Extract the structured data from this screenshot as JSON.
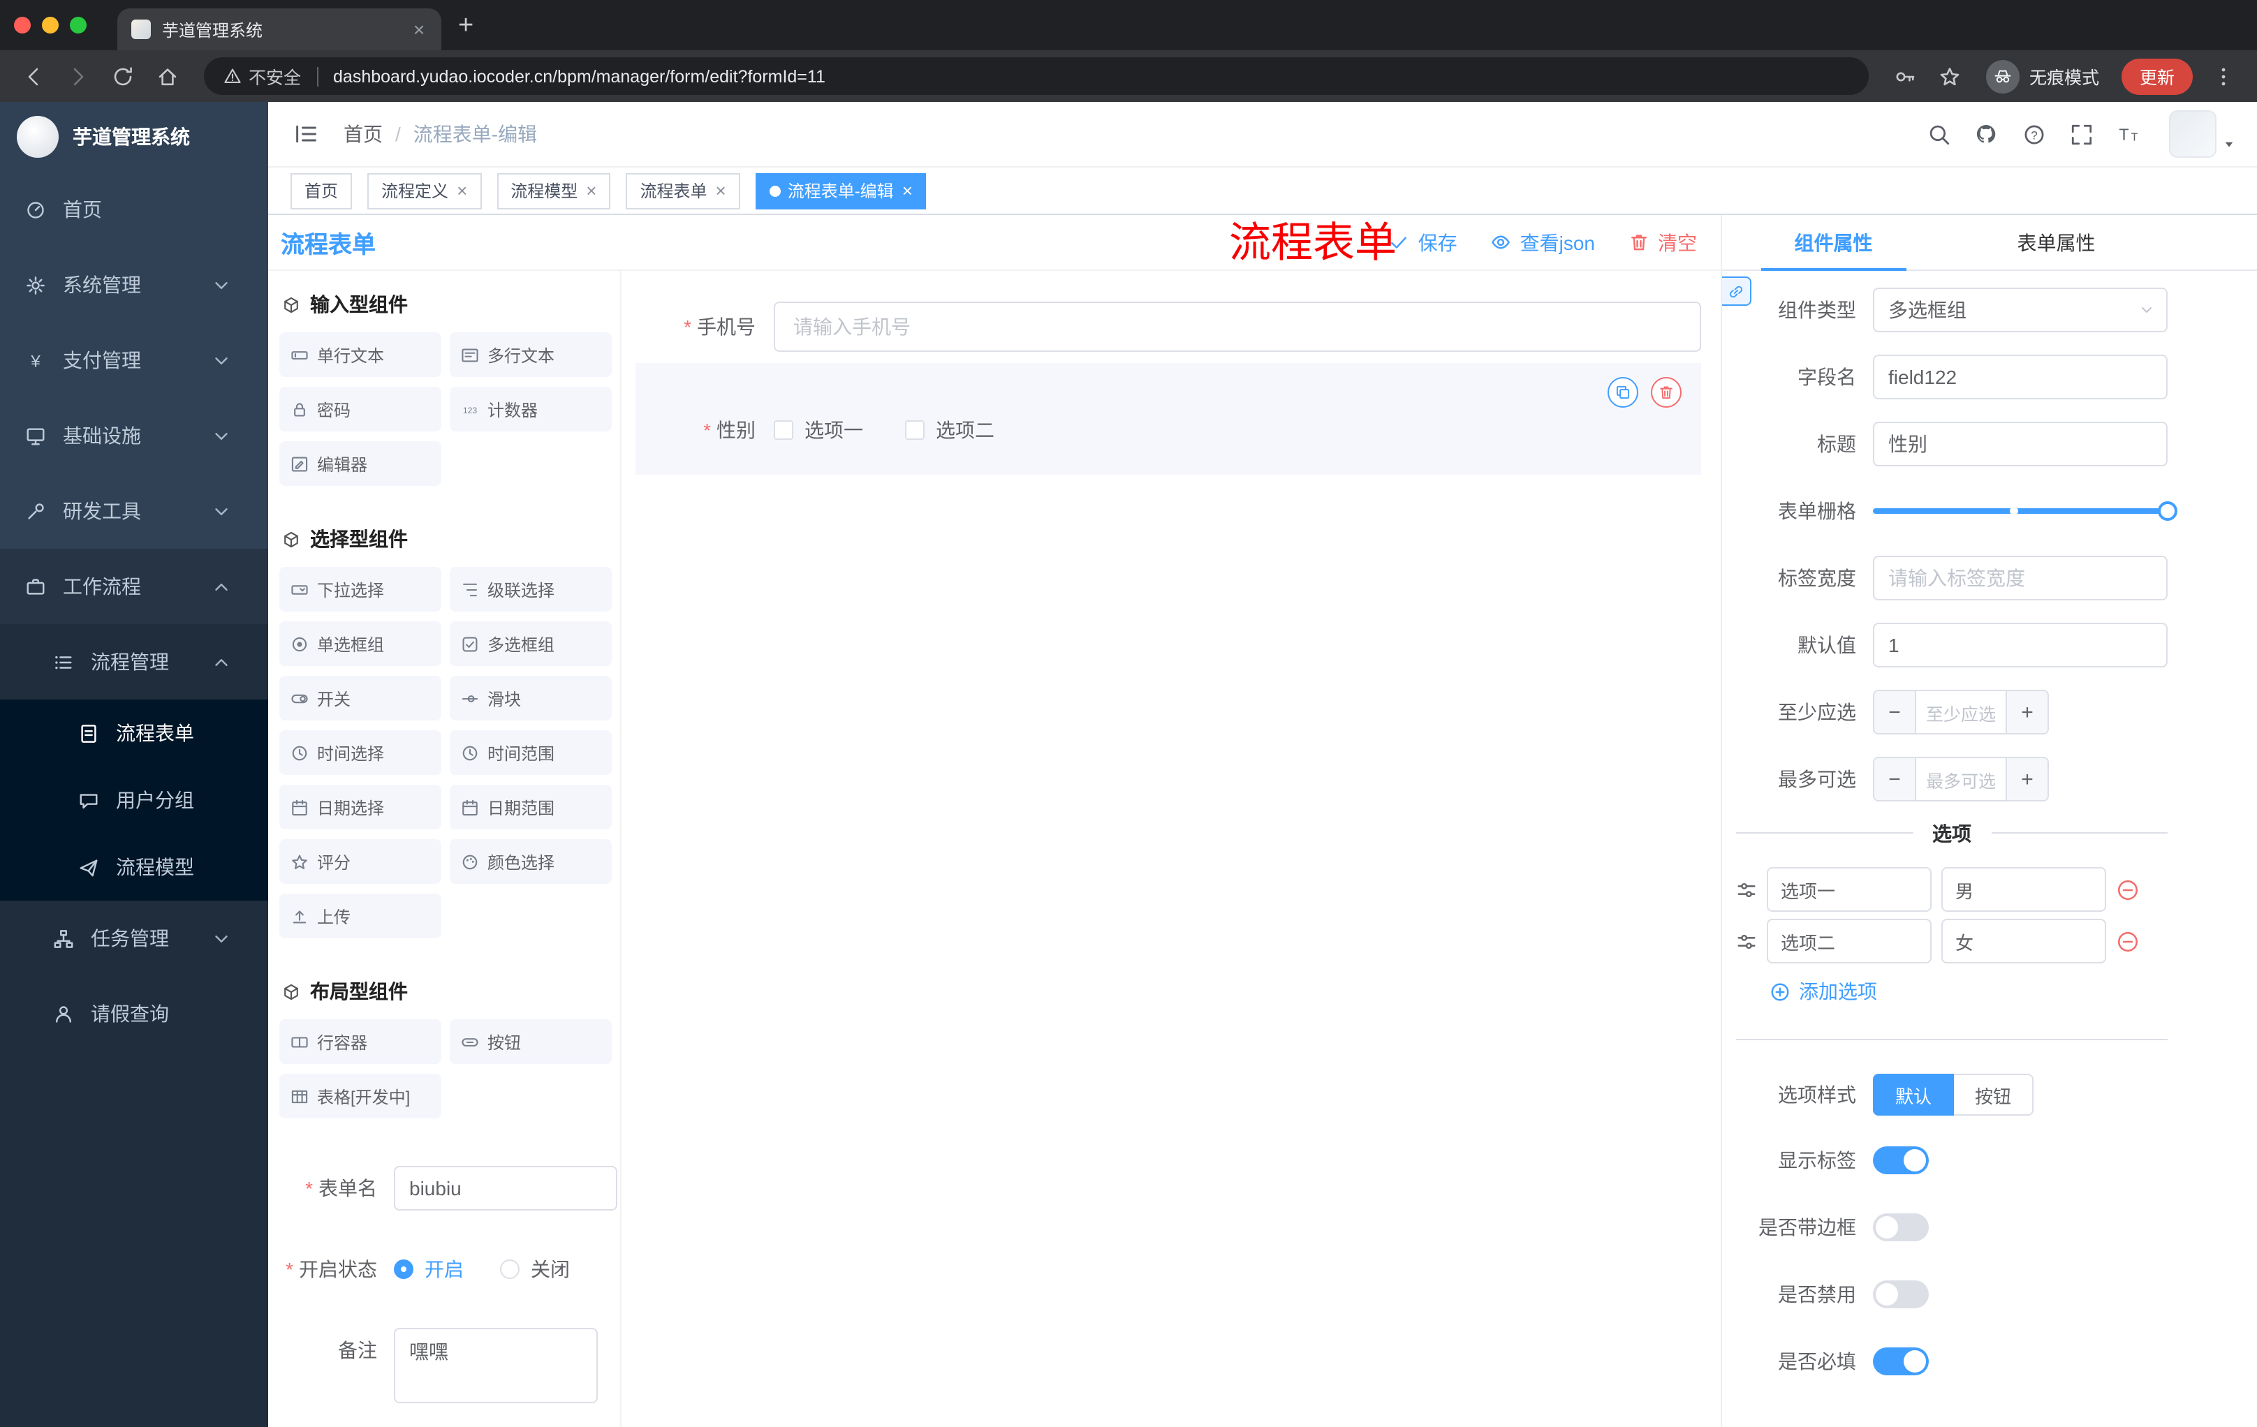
{
  "browser": {
    "tab_title": "芋道管理系统",
    "security_label": "不安全",
    "url": "dashboard.yudao.iocoder.cn/bpm/manager/form/edit?formId=11",
    "incognito_label": "无痕模式",
    "update_label": "更新"
  },
  "annotation": {
    "text": "流程表单",
    "color": "#f70000"
  },
  "sidebar": {
    "logo_title": "芋道管理系统",
    "items": [
      {
        "label": "首页"
      },
      {
        "label": "系统管理"
      },
      {
        "label": "支付管理"
      },
      {
        "label": "基础设施"
      },
      {
        "label": "研发工具"
      },
      {
        "label": "工作流程"
      },
      {
        "label": "流程管理"
      },
      {
        "label": "流程表单"
      },
      {
        "label": "用户分组"
      },
      {
        "label": "流程模型"
      },
      {
        "label": "任务管理"
      },
      {
        "label": "请假查询"
      }
    ]
  },
  "header": {
    "breadcrumb_home": "首页",
    "breadcrumb_current": "流程表单-编辑"
  },
  "tags": [
    {
      "label": "首页"
    },
    {
      "label": "流程定义"
    },
    {
      "label": "流程模型"
    },
    {
      "label": "流程表单"
    },
    {
      "label": "流程表单-编辑"
    }
  ],
  "designer": {
    "title": "流程表单",
    "actions": {
      "save": "保存",
      "view_json": "查看json",
      "clear": "清空"
    },
    "palette": {
      "sections": [
        {
          "title": "输入型组件",
          "items": [
            "单行文本",
            "多行文本",
            "密码",
            "计数器",
            "编辑器"
          ]
        },
        {
          "title": "选择型组件",
          "items": [
            "下拉选择",
            "级联选择",
            "单选框组",
            "多选框组",
            "开关",
            "滑块",
            "时间选择",
            "时间范围",
            "日期选择",
            "日期范围",
            "评分",
            "颜色选择",
            "上传"
          ]
        },
        {
          "title": "布局型组件",
          "items": [
            "行容器",
            "按钮",
            "表格[开发中]"
          ]
        }
      ]
    },
    "meta": {
      "name_label": "表单名",
      "name_value": "biubiu",
      "status_label": "开启状态",
      "status_on": "开启",
      "status_off": "关闭",
      "remark_label": "备注",
      "remark_value": "嘿嘿"
    },
    "canvas": {
      "phone": {
        "label": "手机号",
        "placeholder": "请输入手机号"
      },
      "gender": {
        "label": "性别",
        "options": [
          "选项一",
          "选项二"
        ]
      }
    }
  },
  "props": {
    "tabs": {
      "component": "组件属性",
      "form": "表单属性"
    },
    "rows": {
      "type_label": "组件类型",
      "type_value": "多选框组",
      "field_label": "字段名",
      "field_value": "field122",
      "title_label": "标题",
      "title_value": "性别",
      "grid_label": "表单栅格",
      "width_label": "标签宽度",
      "width_placeholder": "请输入标签宽度",
      "default_label": "默认值",
      "default_value": "1",
      "min_label": "至少应选",
      "min_placeholder": "至少应选",
      "max_label": "最多可选",
      "max_placeholder": "最多可选"
    },
    "options": {
      "divider_title": "选项",
      "rows": [
        {
          "label": "选项一",
          "value": "男"
        },
        {
          "label": "选项二",
          "value": "女"
        }
      ],
      "add_label": "添加选项"
    },
    "style": {
      "label": "选项样式",
      "default": "默认",
      "button": "按钮"
    },
    "switches": [
      {
        "label": "显示标签",
        "on": true
      },
      {
        "label": "是否带边框",
        "on": false
      },
      {
        "label": "是否禁用",
        "on": false
      },
      {
        "label": "是否必填",
        "on": true
      }
    ],
    "colors": {
      "accent": "#409eff",
      "danger": "#f56c6c",
      "sidebar": "#304156"
    }
  }
}
